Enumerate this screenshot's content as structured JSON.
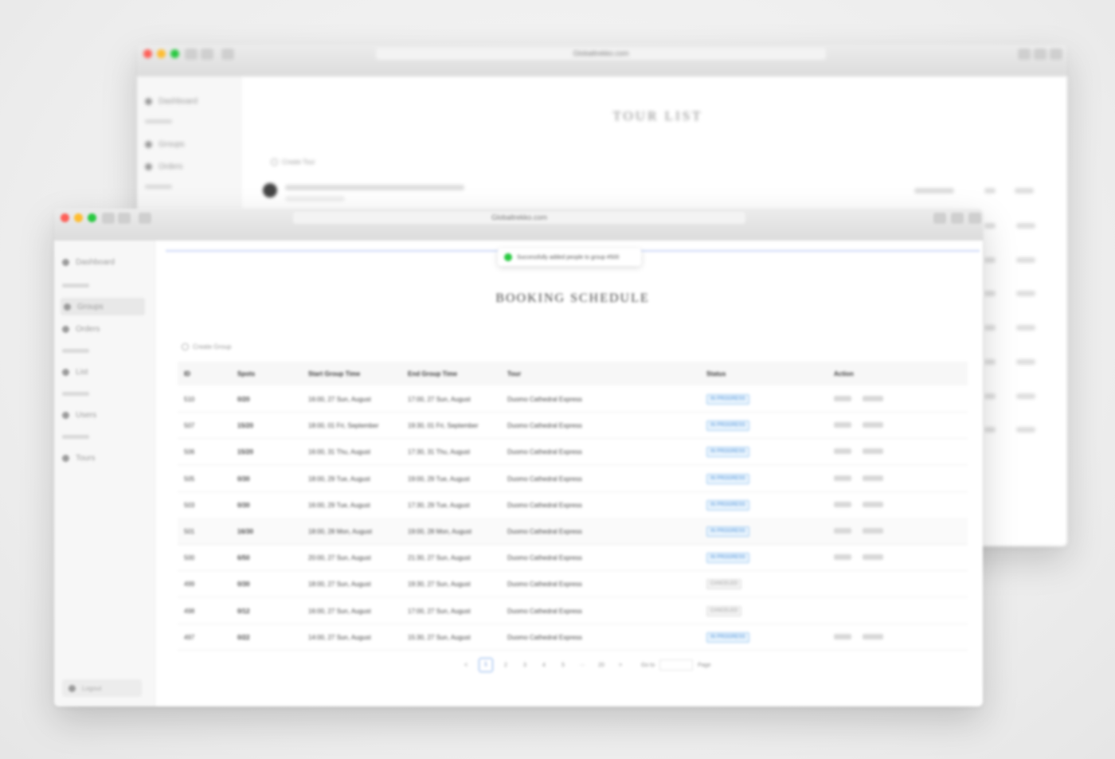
{
  "back_window": {
    "url": "Globaltrekko.com",
    "page_title": "TOUR LIST",
    "add_label": "Create Tour",
    "sidebar": [
      "Dashboard",
      "Groups",
      "Orders"
    ],
    "view_label": "Book"
  },
  "front_window": {
    "url": "Globaltrekko.com",
    "toast": "Successfully added people to group #500",
    "page_title": "BOOKING SCHEDULE",
    "add_label": "Create Group",
    "sidebar": [
      "Dashboard",
      "Groups",
      "Orders",
      "List",
      "Users",
      "Tours"
    ],
    "logout_label": "Logout",
    "columns": [
      "ID",
      "Spots",
      "Start Group Time",
      "End Group Time",
      "Tour",
      "Status",
      "Action"
    ],
    "rows": [
      {
        "id": "510",
        "spots": "0/20",
        "start": "16:00, 27 Sun, August",
        "end": "17:00, 27 Sun, August",
        "tour": "Duomo Cathedral Express",
        "status": "IN PROGRESS",
        "status_type": "active",
        "actions": true,
        "highlight": false
      },
      {
        "id": "507",
        "spots": "15/20",
        "start": "18:00, 01 Fri, September",
        "end": "19:30, 01 Fri, September",
        "tour": "Duomo Cathedral Express",
        "status": "IN PROGRESS",
        "status_type": "active",
        "actions": true,
        "highlight": false
      },
      {
        "id": "506",
        "spots": "15/20",
        "start": "16:00, 31 Thu, August",
        "end": "17:30, 31 Thu, August",
        "tour": "Duomo Cathedral Express",
        "status": "IN PROGRESS",
        "status_type": "active",
        "actions": true,
        "highlight": false
      },
      {
        "id": "505",
        "spots": "0/30",
        "start": "18:00, 29 Tue, August",
        "end": "19:00, 29 Tue, August",
        "tour": "Duomo Cathedral Express",
        "status": "IN PROGRESS",
        "status_type": "active",
        "actions": true,
        "highlight": false
      },
      {
        "id": "503",
        "spots": "0/30",
        "start": "16:00, 29 Tue, August",
        "end": "17:30, 29 Tue, August",
        "tour": "Duomo Cathedral Express",
        "status": "IN PROGRESS",
        "status_type": "active",
        "actions": true,
        "highlight": false
      },
      {
        "id": "501",
        "spots": "16/30",
        "start": "18:00, 28 Mon, August",
        "end": "19:00, 28 Mon, August",
        "tour": "Duomo Cathedral Express",
        "status": "IN PROGRESS",
        "status_type": "active",
        "actions": true,
        "highlight": true
      },
      {
        "id": "500",
        "spots": "6/50",
        "start": "20:00, 27 Sun, August",
        "end": "21:30, 27 Sun, August",
        "tour": "Duomo Cathedral Express",
        "status": "IN PROGRESS",
        "status_type": "active",
        "actions": true,
        "highlight": false
      },
      {
        "id": "499",
        "spots": "0/30",
        "start": "18:00, 27 Sun, August",
        "end": "19:30, 27 Sun, August",
        "tour": "Duomo Cathedral Express",
        "status": "CANCELED",
        "status_type": "canceled",
        "actions": false,
        "highlight": false
      },
      {
        "id": "498",
        "spots": "0/12",
        "start": "16:00, 27 Sun, August",
        "end": "17:00, 27 Sun, August",
        "tour": "Duomo Cathedral Express",
        "status": "CANCELED",
        "status_type": "canceled",
        "actions": false,
        "highlight": false
      },
      {
        "id": "497",
        "spots": "0/22",
        "start": "14:00, 27 Sun, August",
        "end": "15:30, 27 Sun, August",
        "tour": "Duomo Cathedral Express",
        "status": "IN PROGRESS",
        "status_type": "active",
        "actions": true,
        "highlight": false
      }
    ],
    "pagination": {
      "prev": "<",
      "pages": [
        "1",
        "2",
        "3",
        "4",
        "5"
      ],
      "ellipsis": "···",
      "last": "20",
      "next": ">",
      "active": "1",
      "goto_label": "Go to",
      "page_label": "Page"
    }
  },
  "colors": {
    "status_active": "#3b86d6",
    "toast_check": "#28c840",
    "traffic_red": "#fe5f57",
    "traffic_yellow": "#febc2e",
    "traffic_green": "#28c840"
  }
}
